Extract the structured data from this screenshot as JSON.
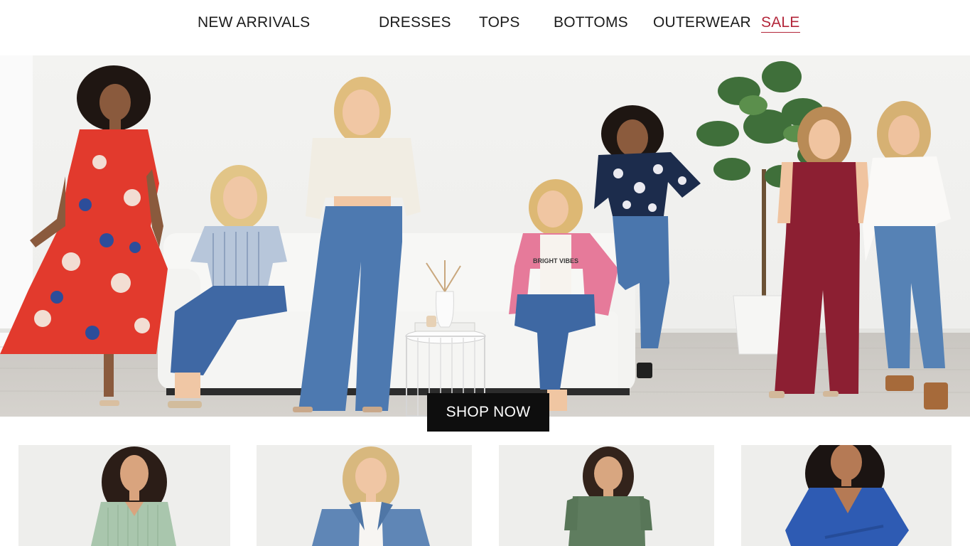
{
  "nav": {
    "items": [
      {
        "label": "NEW ARRIVALS",
        "name": "nav-new-arrivals"
      },
      {
        "label": "DRESSES",
        "name": "nav-dresses"
      },
      {
        "label": "TOPS",
        "name": "nav-tops"
      },
      {
        "label": "BOTTOMS",
        "name": "nav-bottoms"
      },
      {
        "label": "OUTERWEAR",
        "name": "nav-outerwear"
      },
      {
        "label": "SALE",
        "name": "nav-sale"
      }
    ],
    "sale_color": "#b3263a"
  },
  "hero": {
    "cta_label": "SHOP NOW",
    "cta_color": "#0e0e0e",
    "shirt_print": "BRIGHT VIBES"
  },
  "products": [
    {
      "name": "product-card-sage-top",
      "color": "#a9c6ad",
      "hair": "#2b1d17"
    },
    {
      "name": "product-card-denim-jacket",
      "color": "#5f86b6",
      "hair": "#d8b87e"
    },
    {
      "name": "product-card-green-tee",
      "color": "#5f7d5f",
      "hair": "#33231b"
    },
    {
      "name": "product-card-blue-wrap-dress",
      "color": "#2e5bb3",
      "hair": "#1b1412"
    }
  ]
}
